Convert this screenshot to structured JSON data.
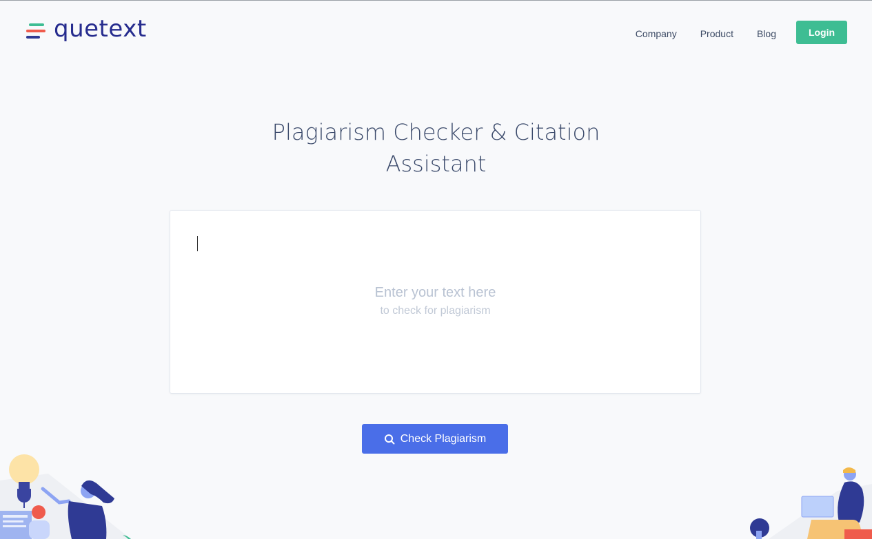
{
  "brand": {
    "name": "quetext"
  },
  "nav": {
    "items": [
      "Company",
      "Product",
      "Blog"
    ],
    "login_label": "Login"
  },
  "hero": {
    "title_line1": "Plagiarism Checker & Citation",
    "title_line2": "Assistant"
  },
  "editor": {
    "value": "",
    "placeholder_main": "Enter your text here",
    "placeholder_sub": "to check for plagiarism"
  },
  "actions": {
    "check_label": "Check Plagiarism",
    "check_icon": "search-icon"
  },
  "colors": {
    "brand_blue": "#262c8e",
    "accent_green": "#3ebd93",
    "button_blue": "#4a6ee8",
    "title_text": "#3b4a6b"
  }
}
